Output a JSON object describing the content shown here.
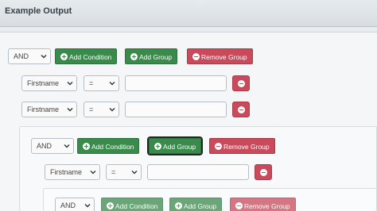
{
  "header": {
    "title": "Example Output"
  },
  "root": {
    "conjunction": "AND",
    "add_condition": "Add Condition",
    "add_group": "Add Group",
    "remove_group": "Remove Group",
    "rules": [
      {
        "field": "Firstname",
        "operator": "=",
        "value": ""
      },
      {
        "field": "Firstname",
        "operator": "=",
        "value": ""
      }
    ]
  },
  "nested_group": {
    "conjunction": "AND",
    "add_condition": "Add Condition",
    "add_group": "Add Group",
    "remove_group": "Remove Group",
    "rules": [
      {
        "field": "Firstname",
        "operator": "=",
        "value": ""
      }
    ]
  },
  "inner_group": {
    "conjunction": "AND",
    "add_condition": "Add Condition",
    "add_group": "Add Group",
    "remove_group": "Remove Group"
  },
  "colors": {
    "success": "#3a8a4c",
    "danger": "#c94a5a"
  },
  "icons": {
    "add": "plus-circle-icon",
    "remove": "minus-circle-icon",
    "dropdown": "chevron-down-icon"
  }
}
